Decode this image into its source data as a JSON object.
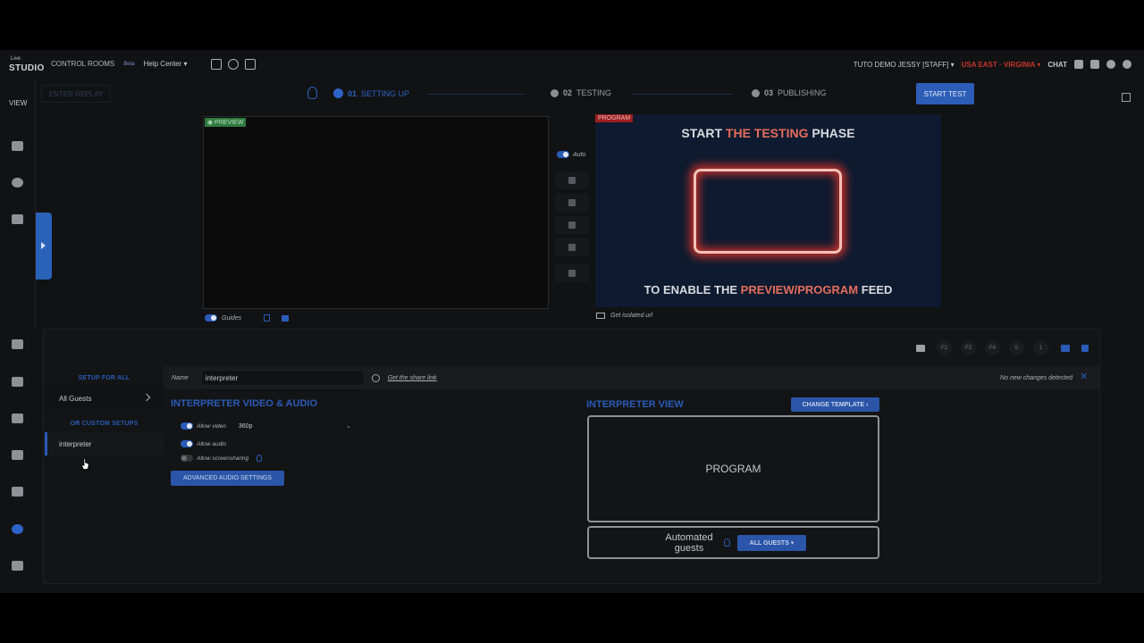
{
  "topnav": {
    "logo_small": "Live",
    "logo_main": "STUDIO",
    "control_rooms": "CONTROL ROOMS",
    "beta": "Beta",
    "help_center": "Help Center ▾",
    "user": "TUTO DEMO JESSY [STAFF] ▾",
    "region": "USA EAST · VIRGINIA ▾",
    "chat": "CHAT"
  },
  "rail": {
    "view_label": "VIEW"
  },
  "steps": {
    "enter_replay": "ENTER REPLAY",
    "step1_num": "01",
    "step1_label": "SETTING UP",
    "step2_num": "02",
    "step2_label": "TESTING",
    "step3_num": "03",
    "step3_label": "PUBLISHING",
    "start_test": "START TEST"
  },
  "preview": {
    "tag": "◉ PREVIEW"
  },
  "program": {
    "tag": "PROGRAM",
    "line1_a": "START ",
    "line1_b": "THE TESTING",
    "line1_c": " PHASE",
    "line2_a": "TO ENABLE THE ",
    "line2_b": "PREVIEW/PROGRAM",
    "line2_c": " FEED"
  },
  "controls": {
    "auto": "Auto",
    "guides": "Guides",
    "isolated": "Get isolated url"
  },
  "panel": {
    "shortcuts": [
      "F2",
      "F3",
      "F4",
      "0",
      "1"
    ],
    "setup_for_all": "SETUP FOR ALL",
    "all_guests": "All Guests",
    "custom_setups": "OR CUSTOM SETUPS",
    "custom_item": "interpreter",
    "name_label": "Name",
    "name_value": "interpreter",
    "share_link": "Get the share link",
    "no_changes": "No new changes detected",
    "av_title": "INTERPRETER VIDEO & AUDIO",
    "allow_video": "Allow video",
    "video_res": "360p",
    "allow_audio": "Allow audio",
    "allow_screensharing": "Allow screensharing",
    "adv_audio": "ADVANCED AUDIO SETTINGS",
    "view_title": "INTERPRETER VIEW",
    "change_template": "CHANGE TEMPLATE ›",
    "program_box": "PROGRAM",
    "automated_guests": "Automated guests",
    "all_guests_btn": "ALL GUESTS ▾"
  },
  "colors": {
    "accent": "#2a5bb8",
    "region": "#c8342c",
    "highlight": "#e56d5c"
  }
}
